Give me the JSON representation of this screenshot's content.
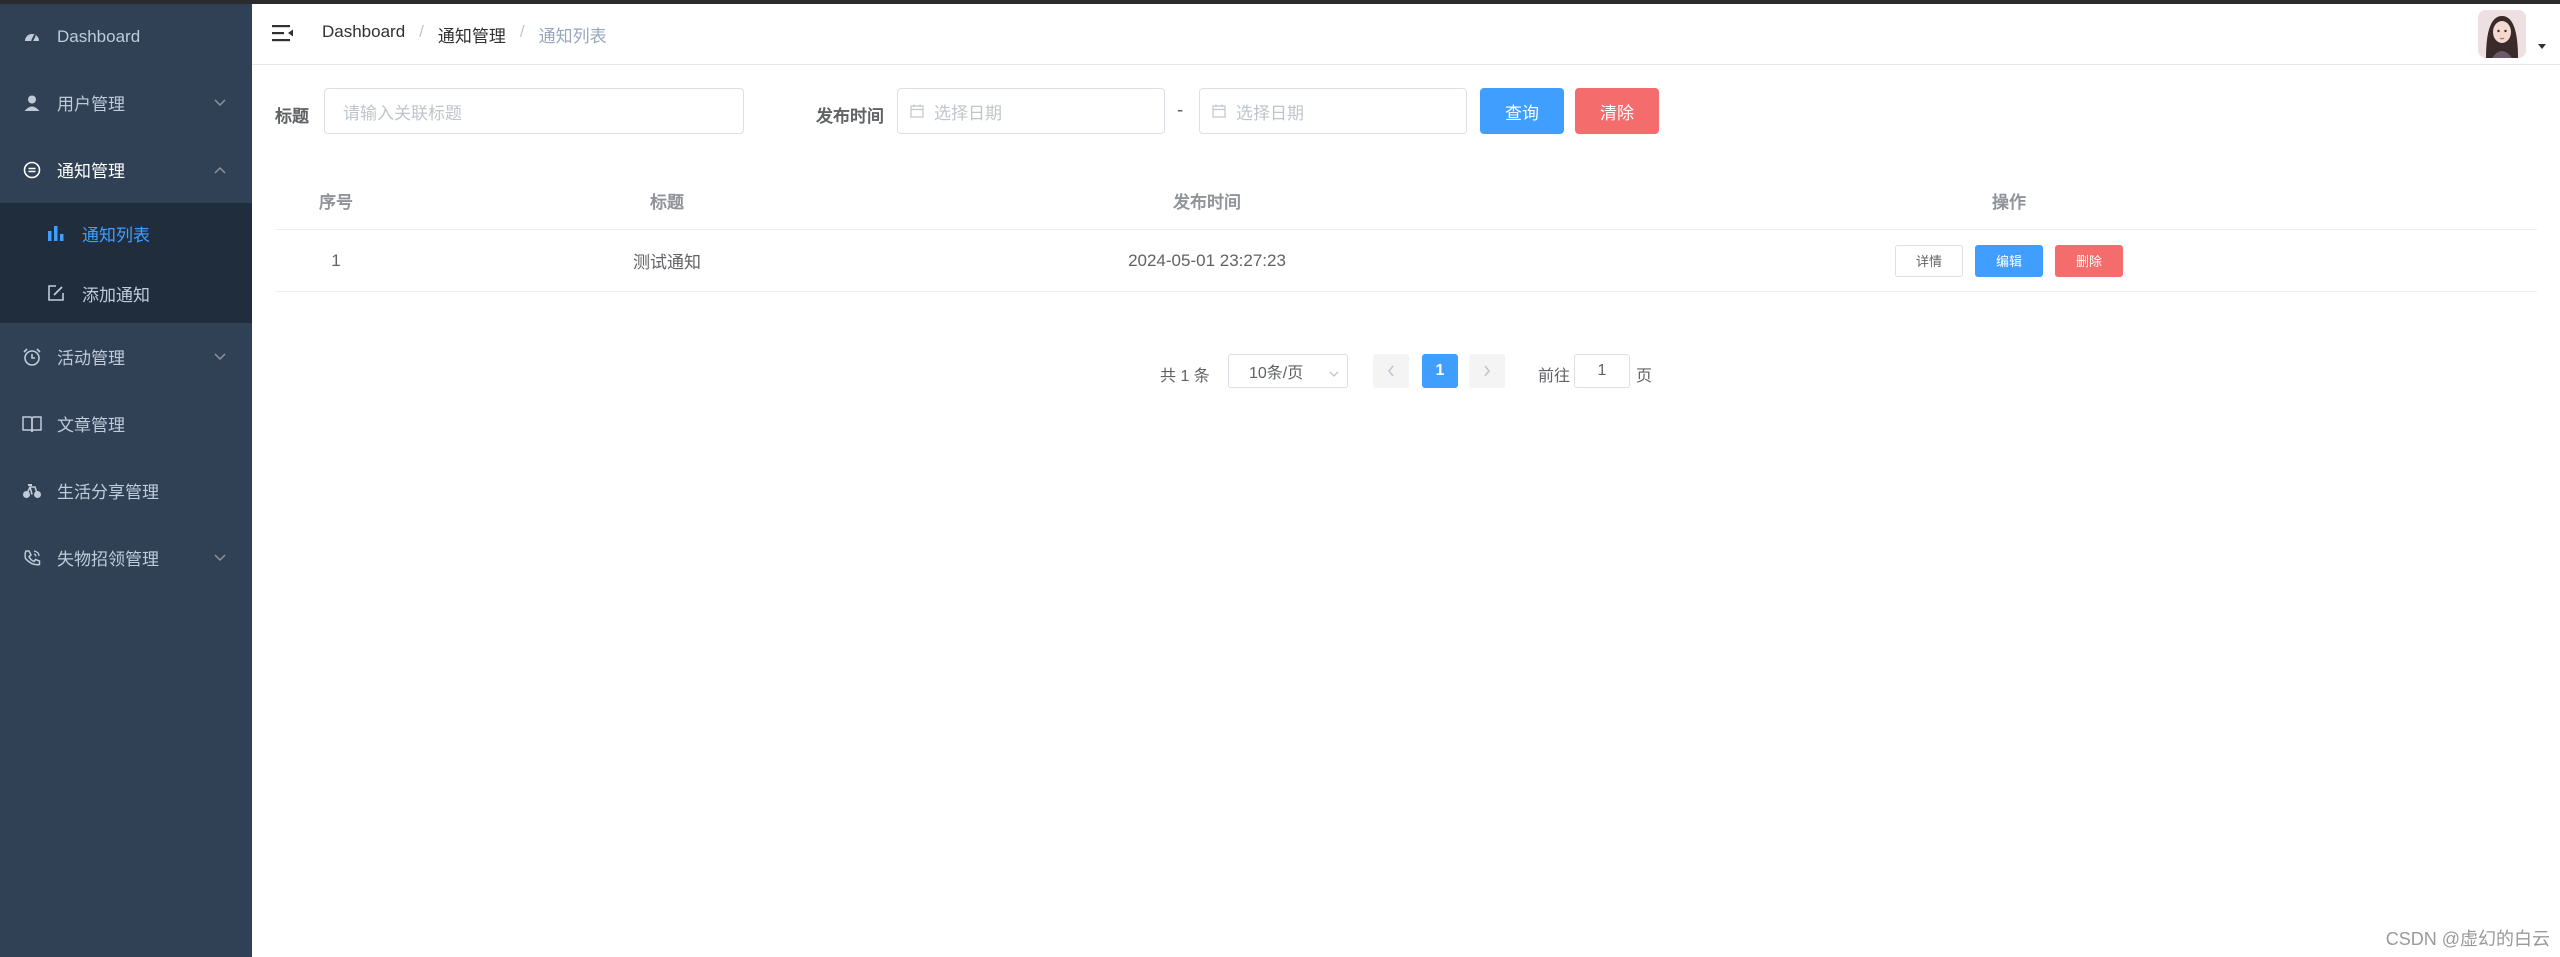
{
  "sidebar": {
    "items": [
      {
        "label": "Dashboard",
        "icon": "dashboard-icon"
      },
      {
        "label": "用户管理",
        "icon": "user-icon"
      },
      {
        "label": "通知管理",
        "icon": "message-icon",
        "expanded": true,
        "children": [
          {
            "label": "通知列表",
            "icon": "chart-icon",
            "active": true
          },
          {
            "label": "添加通知",
            "icon": "edit-icon"
          }
        ]
      },
      {
        "label": "活动管理",
        "icon": "alarm-clock-icon"
      },
      {
        "label": "文章管理",
        "icon": "book-icon"
      },
      {
        "label": "生活分享管理",
        "icon": "bicycle-icon"
      },
      {
        "label": "失物招领管理",
        "icon": "phone-icon"
      }
    ]
  },
  "header": {
    "breadcrumb": [
      "Dashboard",
      "通知管理",
      "通知列表"
    ],
    "separator": "/"
  },
  "search": {
    "title_label": "标题",
    "title_placeholder": "请输入关联标题",
    "date_label": "发布时间",
    "start_placeholder": "选择日期",
    "end_placeholder": "选择日期",
    "range_separator": "-",
    "query_label": "查询",
    "clear_label": "清除"
  },
  "table": {
    "columns": [
      "序号",
      "标题",
      "发布时间",
      "操作"
    ],
    "rows": [
      {
        "index": "1",
        "title": "测试通知",
        "time": "2024-05-01 23:27:23"
      }
    ],
    "actions": {
      "detail": "详情",
      "edit": "编辑",
      "delete": "删除"
    }
  },
  "pagination": {
    "total_text": "共 1 条",
    "page_size": "10条/页",
    "current_page": "1",
    "goto_prefix": "前往",
    "goto_value": "1",
    "goto_suffix": "页"
  },
  "watermark": "CSDN @虚幻的白云",
  "colors": {
    "sidebar_bg": "#304156",
    "submenu_bg": "#1f2d3d",
    "primary": "#409eff",
    "danger": "#f56c6c"
  }
}
